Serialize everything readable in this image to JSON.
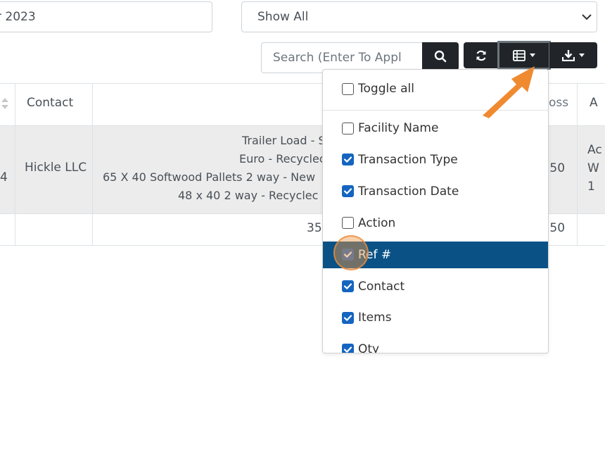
{
  "filters": {
    "date_value": "r 2023",
    "show_select": "Show All"
  },
  "toolbar": {
    "search_placeholder": "Search (Enter To Appl",
    "icons": [
      "search-icon",
      "refresh-icon",
      "columns-icon",
      "download-icon"
    ]
  },
  "table": {
    "headers": {
      "contact": "Contact",
      "partial_col": "oss",
      "partial_col2": "A"
    },
    "row1": {
      "id_frag": "4",
      "contact": "Hickle LLC",
      "items": [
        "Trailer Load - S",
        "Euro - Recyclec",
        "65 X 40 Softwood Pallets 2 way - New",
        "48 x 40 2 way - Recyclec"
      ],
      "amount_frag": ".50",
      "action_frag": [
        "Ac",
        "W",
        "1"
      ]
    },
    "total_row": {
      "qty_frag": "35",
      "amount_frag": ".50"
    }
  },
  "column_menu": {
    "toggle_all": {
      "label": "Toggle all",
      "checked": false
    },
    "items": [
      {
        "label": "Facility Name",
        "checked": false
      },
      {
        "label": "Transaction Type",
        "checked": true
      },
      {
        "label": "Transaction Date",
        "checked": true
      },
      {
        "label": "Action",
        "checked": false
      },
      {
        "label": "Ref #",
        "checked": true
      },
      {
        "label": "Contact",
        "checked": true
      },
      {
        "label": "Items",
        "checked": true
      },
      {
        "label": "Qty",
        "checked": true
      }
    ],
    "highlight_color": "#0a5286",
    "selected_label": "Ref #"
  },
  "colors": {
    "accent_arrow": "#f08a30",
    "checkbox": "#1565c0",
    "dark_button": "#212529"
  }
}
